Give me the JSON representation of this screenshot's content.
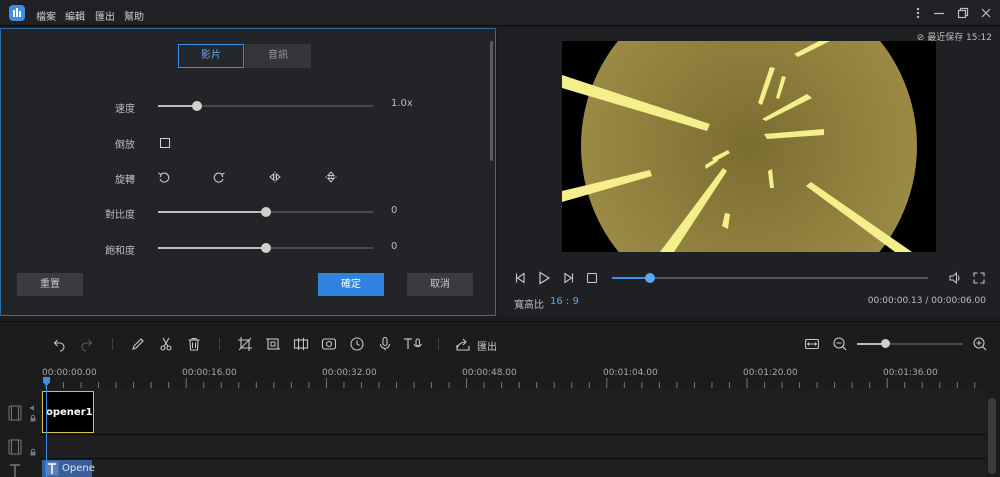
{
  "menu": {
    "items": [
      "檔案",
      "編輯",
      "匯出",
      "幫助"
    ]
  },
  "left_panel": {
    "tabs": [
      {
        "label": "影片",
        "active": true
      },
      {
        "label": "音訊",
        "active": false
      }
    ],
    "speed": {
      "label": "速度",
      "value_text": "1.0x",
      "level": 0.18
    },
    "reverse": {
      "label": "倒放",
      "checked": false
    },
    "rotate": {
      "label": "旋轉",
      "icons": [
        "rotate-left-icon",
        "rotate-right-icon",
        "flip-horizontal-icon",
        "flip-vertical-icon"
      ]
    },
    "contrast": {
      "label": "對比度",
      "value_text": "0",
      "level": 0.5
    },
    "saturation": {
      "label": "飽和度",
      "value_text": "0",
      "level": 0.5
    },
    "buttons": {
      "reset": "重置",
      "ok": "確定",
      "cancel": "取消"
    }
  },
  "right_panel": {
    "save_status": "最近保存 15:12",
    "aspect_label": "寬高比",
    "aspect_value": "16 : 9",
    "timecode": "00:00:00.13 / 00:00:06.00",
    "progress": 0.12
  },
  "toolbar": {
    "export_label": "匯出",
    "zoom_level": 0.27
  },
  "timeline": {
    "ruler_labels": [
      "00:00:00.00",
      "00:00:16.00",
      "00:00:32.00",
      "00:00:48.00",
      "00:01:04.00",
      "00:01:20.00",
      "00:01:36.00"
    ],
    "video_clip": "opener1",
    "text_clip": "Opene"
  },
  "colors": {
    "accent": "#3d8ee8",
    "clip_border": "#d6c23e",
    "preview_circle": "#8c7d3a",
    "rays": "#f4ef8a"
  }
}
